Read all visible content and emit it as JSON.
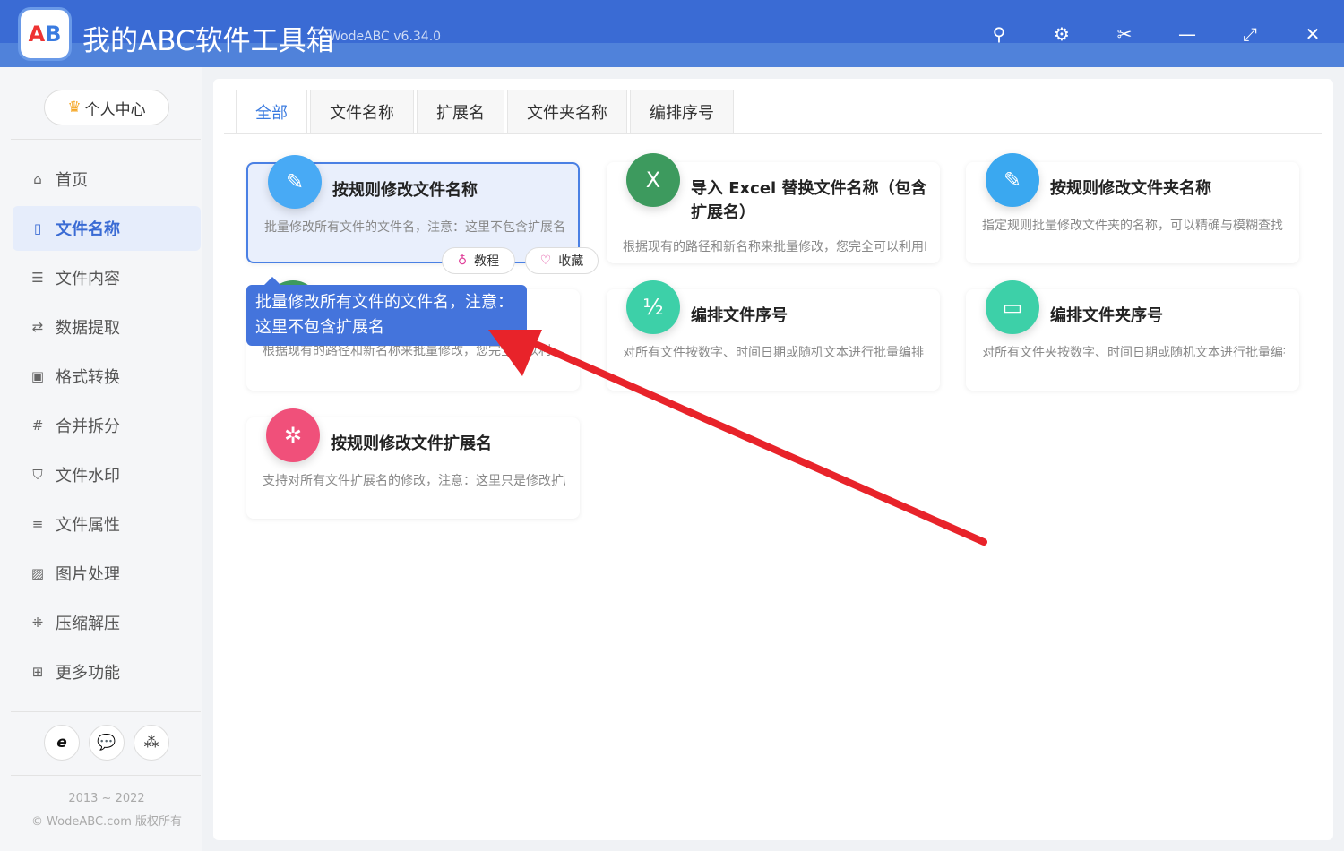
{
  "app": {
    "title": "我的ABC软件工具箱",
    "version": "WodeABC v6.34.0",
    "logo_text": "AB"
  },
  "sidebar": {
    "user_center": "个人中心",
    "items": [
      {
        "label": "首页",
        "icon": "⌂"
      },
      {
        "label": "文件名称",
        "icon": "▯"
      },
      {
        "label": "文件内容",
        "icon": "☰"
      },
      {
        "label": "数据提取",
        "icon": "⇄"
      },
      {
        "label": "格式转换",
        "icon": "▣"
      },
      {
        "label": "合并拆分",
        "icon": "#"
      },
      {
        "label": "文件水印",
        "icon": "⛉"
      },
      {
        "label": "文件属性",
        "icon": "≡"
      },
      {
        "label": "图片处理",
        "icon": "▨"
      },
      {
        "label": "压缩解压",
        "icon": "⁜"
      },
      {
        "label": "更多功能",
        "icon": "⊞"
      }
    ],
    "footer_years": "2013 ~ 2022",
    "footer_copy": "© WodeABC.com 版权所有"
  },
  "tabs": [
    "全部",
    "文件名称",
    "扩展名",
    "文件夹名称",
    "编排序号"
  ],
  "cards": [
    {
      "title": "按规则修改文件名称",
      "desc": "批量修改所有文件的文件名，注意：这里不包含扩展名",
      "color": "#48aaf5"
    },
    {
      "title": "导入 Excel 替换文件名称（包含扩展名）",
      "desc": "根据现有的路径和新名称来批量修改，您完全可以利用Excel",
      "color": "#3d9a5e"
    },
    {
      "title": "按规则修改文件夹名称",
      "desc": "指定规则批量修改文件夹的名称，可以精确与模糊查找",
      "color": "#3aa8f0"
    },
    {
      "title": "",
      "desc": "根据现有的路径和新名称来批量修改，您完全可以利",
      "color": "#3d9a5e"
    },
    {
      "title": "编排文件序号",
      "desc": "对所有文件按数字、时间日期或随机文本进行批量编排",
      "color": "#3dd0a8"
    },
    {
      "title": "编排文件夹序号",
      "desc": "对所有文件夹按数字、时间日期或随机文本进行批量编排",
      "color": "#3dd0a8"
    },
    {
      "title": "按规则修改文件扩展名",
      "desc": "支持对所有文件扩展名的修改，注意：这里只是修改扩展名",
      "color": "#f0507a"
    }
  ],
  "card_actions": {
    "tutorial": "教程",
    "favorite": "收藏"
  },
  "tooltip": "批量修改所有文件的文件名，注意：这里不包含扩展名"
}
